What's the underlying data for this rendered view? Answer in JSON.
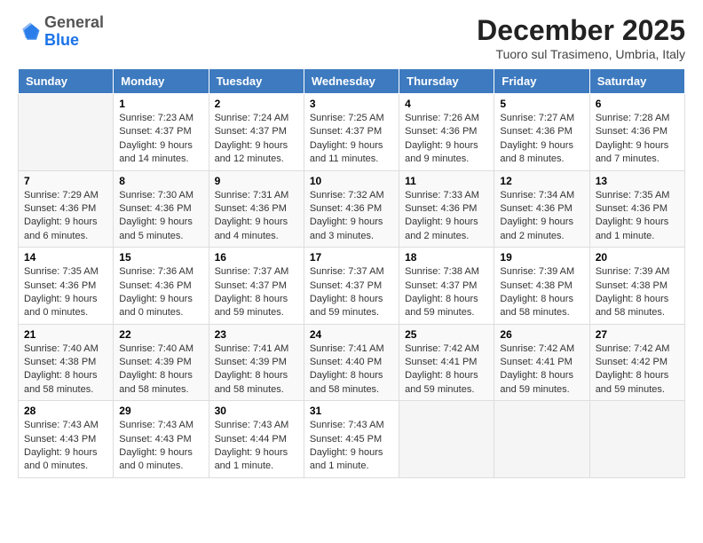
{
  "logo": {
    "general": "General",
    "blue": "Blue"
  },
  "header": {
    "month": "December 2025",
    "location": "Tuoro sul Trasimeno, Umbria, Italy"
  },
  "weekdays": [
    "Sunday",
    "Monday",
    "Tuesday",
    "Wednesday",
    "Thursday",
    "Friday",
    "Saturday"
  ],
  "weeks": [
    [
      {
        "day": "",
        "info": ""
      },
      {
        "day": "1",
        "info": "Sunrise: 7:23 AM\nSunset: 4:37 PM\nDaylight: 9 hours\nand 14 minutes."
      },
      {
        "day": "2",
        "info": "Sunrise: 7:24 AM\nSunset: 4:37 PM\nDaylight: 9 hours\nand 12 minutes."
      },
      {
        "day": "3",
        "info": "Sunrise: 7:25 AM\nSunset: 4:37 PM\nDaylight: 9 hours\nand 11 minutes."
      },
      {
        "day": "4",
        "info": "Sunrise: 7:26 AM\nSunset: 4:36 PM\nDaylight: 9 hours\nand 9 minutes."
      },
      {
        "day": "5",
        "info": "Sunrise: 7:27 AM\nSunset: 4:36 PM\nDaylight: 9 hours\nand 8 minutes."
      },
      {
        "day": "6",
        "info": "Sunrise: 7:28 AM\nSunset: 4:36 PM\nDaylight: 9 hours\nand 7 minutes."
      }
    ],
    [
      {
        "day": "7",
        "info": "Sunrise: 7:29 AM\nSunset: 4:36 PM\nDaylight: 9 hours\nand 6 minutes."
      },
      {
        "day": "8",
        "info": "Sunrise: 7:30 AM\nSunset: 4:36 PM\nDaylight: 9 hours\nand 5 minutes."
      },
      {
        "day": "9",
        "info": "Sunrise: 7:31 AM\nSunset: 4:36 PM\nDaylight: 9 hours\nand 4 minutes."
      },
      {
        "day": "10",
        "info": "Sunrise: 7:32 AM\nSunset: 4:36 PM\nDaylight: 9 hours\nand 3 minutes."
      },
      {
        "day": "11",
        "info": "Sunrise: 7:33 AM\nSunset: 4:36 PM\nDaylight: 9 hours\nand 2 minutes."
      },
      {
        "day": "12",
        "info": "Sunrise: 7:34 AM\nSunset: 4:36 PM\nDaylight: 9 hours\nand 2 minutes."
      },
      {
        "day": "13",
        "info": "Sunrise: 7:35 AM\nSunset: 4:36 PM\nDaylight: 9 hours\nand 1 minute."
      }
    ],
    [
      {
        "day": "14",
        "info": "Sunrise: 7:35 AM\nSunset: 4:36 PM\nDaylight: 9 hours\nand 0 minutes."
      },
      {
        "day": "15",
        "info": "Sunrise: 7:36 AM\nSunset: 4:36 PM\nDaylight: 9 hours\nand 0 minutes."
      },
      {
        "day": "16",
        "info": "Sunrise: 7:37 AM\nSunset: 4:37 PM\nDaylight: 8 hours\nand 59 minutes."
      },
      {
        "day": "17",
        "info": "Sunrise: 7:37 AM\nSunset: 4:37 PM\nDaylight: 8 hours\nand 59 minutes."
      },
      {
        "day": "18",
        "info": "Sunrise: 7:38 AM\nSunset: 4:37 PM\nDaylight: 8 hours\nand 59 minutes."
      },
      {
        "day": "19",
        "info": "Sunrise: 7:39 AM\nSunset: 4:38 PM\nDaylight: 8 hours\nand 58 minutes."
      },
      {
        "day": "20",
        "info": "Sunrise: 7:39 AM\nSunset: 4:38 PM\nDaylight: 8 hours\nand 58 minutes."
      }
    ],
    [
      {
        "day": "21",
        "info": "Sunrise: 7:40 AM\nSunset: 4:38 PM\nDaylight: 8 hours\nand 58 minutes."
      },
      {
        "day": "22",
        "info": "Sunrise: 7:40 AM\nSunset: 4:39 PM\nDaylight: 8 hours\nand 58 minutes."
      },
      {
        "day": "23",
        "info": "Sunrise: 7:41 AM\nSunset: 4:39 PM\nDaylight: 8 hours\nand 58 minutes."
      },
      {
        "day": "24",
        "info": "Sunrise: 7:41 AM\nSunset: 4:40 PM\nDaylight: 8 hours\nand 58 minutes."
      },
      {
        "day": "25",
        "info": "Sunrise: 7:42 AM\nSunset: 4:41 PM\nDaylight: 8 hours\nand 59 minutes."
      },
      {
        "day": "26",
        "info": "Sunrise: 7:42 AM\nSunset: 4:41 PM\nDaylight: 8 hours\nand 59 minutes."
      },
      {
        "day": "27",
        "info": "Sunrise: 7:42 AM\nSunset: 4:42 PM\nDaylight: 8 hours\nand 59 minutes."
      }
    ],
    [
      {
        "day": "28",
        "info": "Sunrise: 7:43 AM\nSunset: 4:43 PM\nDaylight: 9 hours\nand 0 minutes."
      },
      {
        "day": "29",
        "info": "Sunrise: 7:43 AM\nSunset: 4:43 PM\nDaylight: 9 hours\nand 0 minutes."
      },
      {
        "day": "30",
        "info": "Sunrise: 7:43 AM\nSunset: 4:44 PM\nDaylight: 9 hours\nand 1 minute."
      },
      {
        "day": "31",
        "info": "Sunrise: 7:43 AM\nSunset: 4:45 PM\nDaylight: 9 hours\nand 1 minute."
      },
      {
        "day": "",
        "info": ""
      },
      {
        "day": "",
        "info": ""
      },
      {
        "day": "",
        "info": ""
      }
    ]
  ]
}
